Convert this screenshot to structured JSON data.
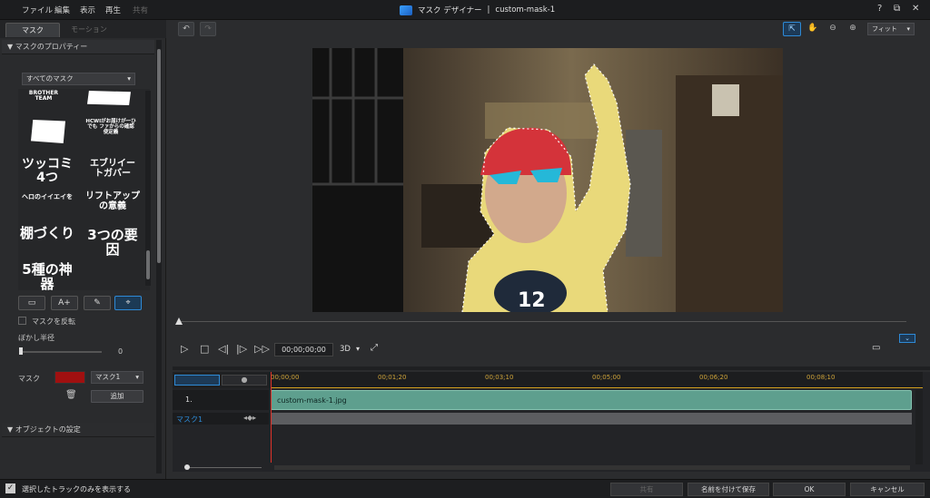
{
  "menu": {
    "file": "ファイル",
    "edit": "編集",
    "view": "表示",
    "play": "再生",
    "share": "共有"
  },
  "window": {
    "title": "マスク デザイナー",
    "separator": "|",
    "filename": "custom-mask-1",
    "help": "?",
    "restore": "⧉",
    "close": "✕"
  },
  "left_tabs": {
    "mask": "マスク",
    "motion": "モーション"
  },
  "mask_properties": {
    "header": "▼ マスクのプロパティー",
    "category": "すべてのマスク",
    "thumbnails": [
      "BROTHER TEAM",
      "",
      "HCWIがお届けが一ひでも ファからの確認使定義",
      "",
      "ツッコミ4つ",
      "エブリイー トガバー",
      "ヘロのイイエイを",
      "リフトアップの意義",
      "棚づくり",
      "3つの要因",
      "5種の神器"
    ],
    "invert_label": "マスクを反転",
    "blur_label": "ぼかし半径",
    "blur_value": "0",
    "mask_label": "マスク",
    "mask_color": "#a01010",
    "mask_select": "マスク1",
    "add_button": "追加"
  },
  "object_settings": {
    "header": "▼ オブジェクトの設定"
  },
  "preview": {
    "undo": "↶",
    "redo": "↷",
    "fit": "フィット",
    "timecode": "00;00;00;00",
    "mode3d": "3D"
  },
  "timeline": {
    "ticks": [
      "00;00;00",
      "00;01;20",
      "00;03;10",
      "00;05;00",
      "00;06;20",
      "00;08;10"
    ],
    "track_label": "1.",
    "clip_name": "custom-mask-1.jpg",
    "mask_track_label": "マスク1"
  },
  "footer": {
    "show_selected": "選択したトラックのみを表示する",
    "share": "共有",
    "save_as": "名前を付けて保存",
    "ok": "OK",
    "cancel": "キャンセル"
  },
  "accent": "#2e8ad6"
}
